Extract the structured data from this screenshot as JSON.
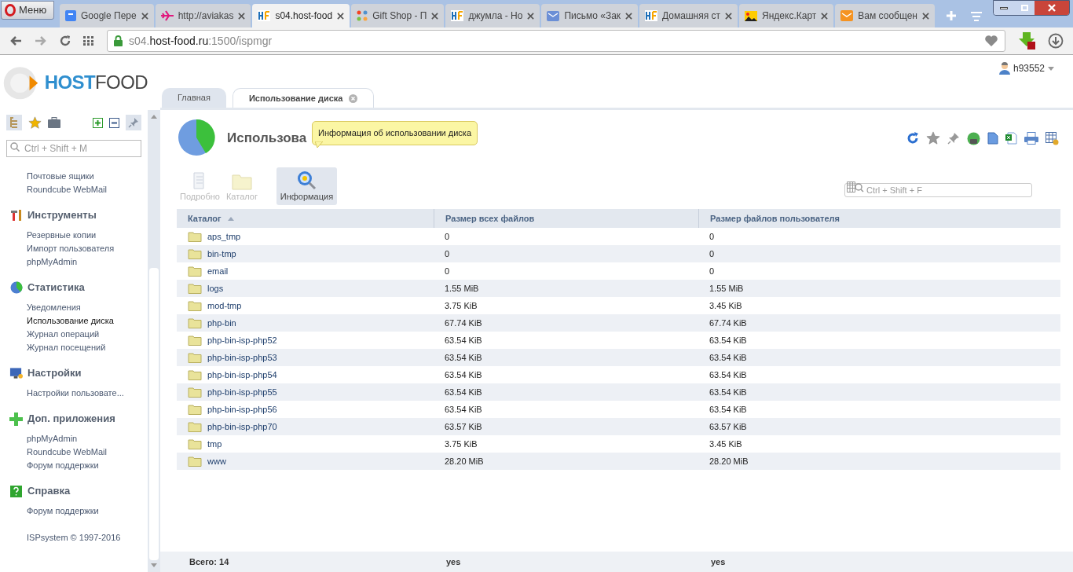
{
  "browser": {
    "menu_button": "Меню",
    "tabs": [
      {
        "title": "Google Пере",
        "selected": false,
        "kind": "translate"
      },
      {
        "title": "http://aviakas",
        "selected": false,
        "kind": "plane"
      },
      {
        "title": "s04.host-food",
        "selected": true,
        "kind": "hf"
      },
      {
        "title": "Gift Shop - П",
        "selected": false,
        "kind": "joomla"
      },
      {
        "title": "джумла - Но",
        "selected": false,
        "kind": "hf"
      },
      {
        "title": "Письмо «Зак",
        "selected": false,
        "kind": "mail"
      },
      {
        "title": "Домашняя ст",
        "selected": false,
        "kind": "hf"
      },
      {
        "title": "Яндекс.Карт",
        "selected": false,
        "kind": "image"
      },
      {
        "title": "Вам сообщен",
        "selected": false,
        "kind": "message"
      }
    ],
    "address": {
      "prefix": "s04.",
      "domain": "host-food.ru",
      "path": ":1500/ispmgr"
    }
  },
  "app": {
    "logo": {
      "strong": "HOST",
      "light": "FOOD"
    },
    "user": "h93552",
    "tabs": [
      {
        "label": "Главная",
        "selected": false,
        "closable": false
      },
      {
        "label": "Использование диска",
        "selected": true,
        "closable": true
      }
    ],
    "sidebar": {
      "search_placeholder": "Ctrl + Shift + M",
      "sections": [
        {
          "items": [
            {
              "label": "Почтовые ящики",
              "selected": false
            },
            {
              "label": "Roundcube WebMail",
              "selected": false
            }
          ]
        },
        {
          "title": "Инструменты",
          "kind": "tools",
          "items": [
            {
              "label": "Резервные копии",
              "selected": false
            },
            {
              "label": "Импорт пользователя",
              "selected": false
            },
            {
              "label": "phpMyAdmin",
              "selected": false
            }
          ]
        },
        {
          "title": "Статистика",
          "kind": "stats",
          "items": [
            {
              "label": "Уведомления",
              "selected": false
            },
            {
              "label": "Использование диска",
              "selected": true
            },
            {
              "label": "Журнал операций",
              "selected": false
            },
            {
              "label": "Журнал посещений",
              "selected": false
            }
          ]
        },
        {
          "title": "Настройки",
          "kind": "settings",
          "items": [
            {
              "label": "Настройки пользовате...",
              "selected": false
            }
          ]
        },
        {
          "title": "Доп. приложения",
          "kind": "apps",
          "items": [
            {
              "label": "phpMyAdmin",
              "selected": false
            },
            {
              "label": "Roundcube WebMail",
              "selected": false
            },
            {
              "label": "Форум поддержки",
              "selected": false
            }
          ]
        },
        {
          "title": "Справка",
          "kind": "help",
          "items": [
            {
              "label": "Форум поддержки",
              "selected": false
            }
          ]
        }
      ],
      "copyright": "ISPsystem © 1997-2016"
    },
    "page": {
      "title": "Использова",
      "tooltip": "Информация об использовании диска",
      "toolbar": [
        {
          "label": "Подробно",
          "disabled": true,
          "selected": false,
          "kind": "details"
        },
        {
          "label": "Каталог",
          "disabled": true,
          "selected": false,
          "kind": "catalog"
        },
        {
          "label": "Информация",
          "disabled": false,
          "selected": true,
          "kind": "info"
        }
      ],
      "filter_placeholder": "Ctrl + Shift + F",
      "table": {
        "columns": [
          "Каталог",
          "Размер всех файлов",
          "Размер файлов пользователя"
        ],
        "rows": [
          [
            "aps_tmp",
            "0",
            "0"
          ],
          [
            "bin-tmp",
            "0",
            "0"
          ],
          [
            "email",
            "0",
            "0"
          ],
          [
            "logs",
            "1.55 MiB",
            "1.55 MiB"
          ],
          [
            "mod-tmp",
            "3.75 KiB",
            "3.45 KiB"
          ],
          [
            "php-bin",
            "67.74 KiB",
            "67.74 KiB"
          ],
          [
            "php-bin-isp-php52",
            "63.54 KiB",
            "63.54 KiB"
          ],
          [
            "php-bin-isp-php53",
            "63.54 KiB",
            "63.54 KiB"
          ],
          [
            "php-bin-isp-php54",
            "63.54 KiB",
            "63.54 KiB"
          ],
          [
            "php-bin-isp-php55",
            "63.54 KiB",
            "63.54 KiB"
          ],
          [
            "php-bin-isp-php56",
            "63.54 KiB",
            "63.54 KiB"
          ],
          [
            "php-bin-isp-php70",
            "63.57 KiB",
            "63.57 KiB"
          ],
          [
            "tmp",
            "3.75 KiB",
            "3.45 KiB"
          ],
          [
            "www",
            "28.20 MiB",
            "28.20 MiB"
          ]
        ],
        "footer": [
          "Всего: 14",
          "yes",
          "yes"
        ]
      }
    }
  }
}
